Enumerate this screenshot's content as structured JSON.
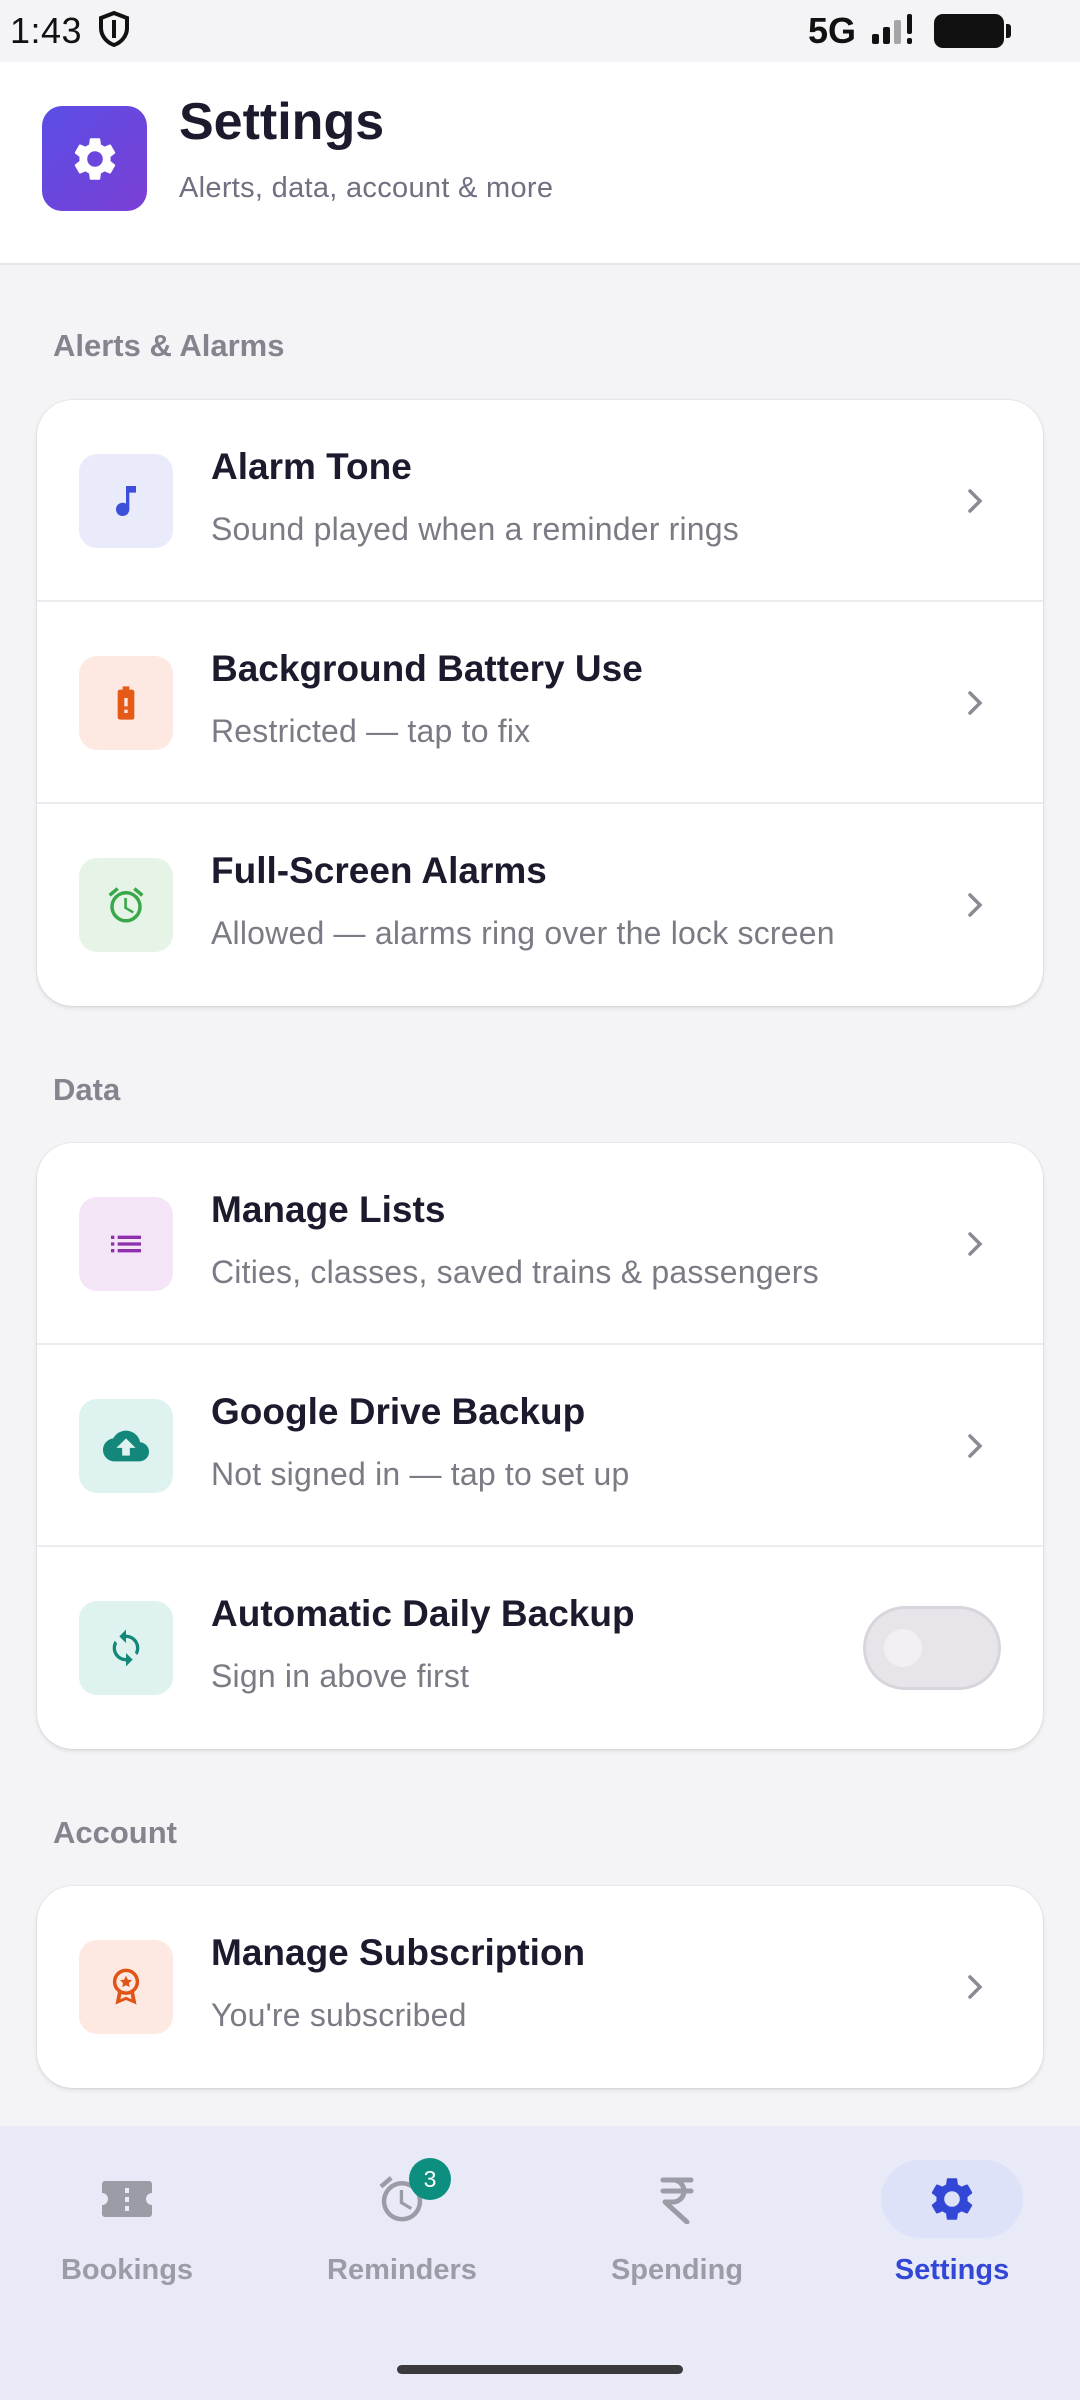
{
  "status_bar": {
    "time": "1:43",
    "network": "5G"
  },
  "header": {
    "title": "Settings",
    "subtitle": "Alerts, data, account & more",
    "icon": "gear-icon",
    "icon_gradient": [
      "#5a4ee6",
      "#7b3fd4"
    ]
  },
  "sections": [
    {
      "label": "Alerts & Alarms",
      "rows": [
        {
          "title": "Alarm Tone",
          "subtitle": "Sound played when a reminder rings",
          "icon": "music-note-icon",
          "icon_bg": "#e9ebfb",
          "icon_color": "#3d4fd8"
        },
        {
          "title": "Background Battery Use",
          "subtitle": "Restricted — tap to fix",
          "icon": "battery-alert-icon",
          "icon_bg": "#fde9e1",
          "icon_color": "#e65a18"
        },
        {
          "title": "Full-Screen Alarms",
          "subtitle": "Allowed — alarms ring over the lock screen",
          "icon": "alarm-clock-icon",
          "icon_bg": "#e6f4e7",
          "icon_color": "#3aa84a"
        }
      ]
    },
    {
      "label": "Data",
      "rows": [
        {
          "title": "Manage Lists",
          "subtitle": "Cities, classes, saved trains & passengers",
          "icon": "list-icon",
          "icon_bg": "#f3e5f6",
          "icon_color": "#8e2fb0"
        },
        {
          "title": "Google Drive Backup",
          "subtitle": "Not signed in — tap to set up",
          "icon": "cloud-upload-icon",
          "icon_bg": "#def2ef",
          "icon_color": "#12877a"
        },
        {
          "title": "Automatic Daily Backup",
          "subtitle": "Sign in above first",
          "icon": "sync-icon",
          "icon_bg": "#def2ef",
          "icon_color": "#12877a",
          "toggle_on": false
        }
      ]
    },
    {
      "label": "Account",
      "rows": [
        {
          "title": "Manage Subscription",
          "subtitle": "You're subscribed",
          "icon": "award-ribbon-icon",
          "icon_bg": "#fde9e1",
          "icon_color": "#e05418"
        }
      ]
    }
  ],
  "bottom_nav": {
    "items": [
      {
        "label": "Bookings",
        "icon": "ticket-icon"
      },
      {
        "label": "Reminders",
        "icon": "alarm-icon",
        "badge": "3"
      },
      {
        "label": "Spending",
        "icon": "rupee-icon"
      },
      {
        "label": "Settings",
        "icon": "gear-icon",
        "active": true
      }
    ],
    "active_color": "#3347d6"
  }
}
